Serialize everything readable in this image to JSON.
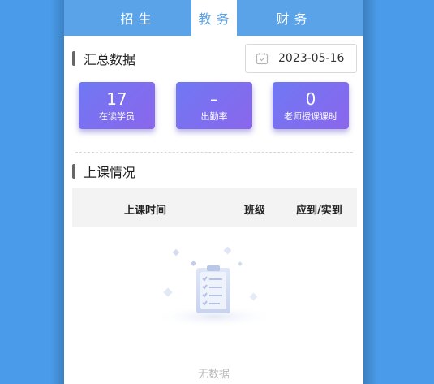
{
  "tabs": [
    {
      "label": "招生",
      "active": false
    },
    {
      "label": "教务",
      "active": true
    },
    {
      "label": "财务",
      "active": false
    }
  ],
  "summary": {
    "title": "汇总数据",
    "date": "2023-05-16",
    "stats": [
      {
        "value": "17",
        "label": "在读学员"
      },
      {
        "value": "–",
        "label": "出勤率"
      },
      {
        "value": "0",
        "label": "老师授课课时"
      }
    ]
  },
  "classes": {
    "title": "上课情况",
    "columns": [
      "上课时间",
      "班级",
      "应到/实到"
    ],
    "empty_text": "无数据"
  },
  "colors": {
    "background": "#4a9cea",
    "tabbar": "#5aa3e8",
    "card_gradient_start": "#6f78f3",
    "card_gradient_end": "#8b66ec"
  }
}
